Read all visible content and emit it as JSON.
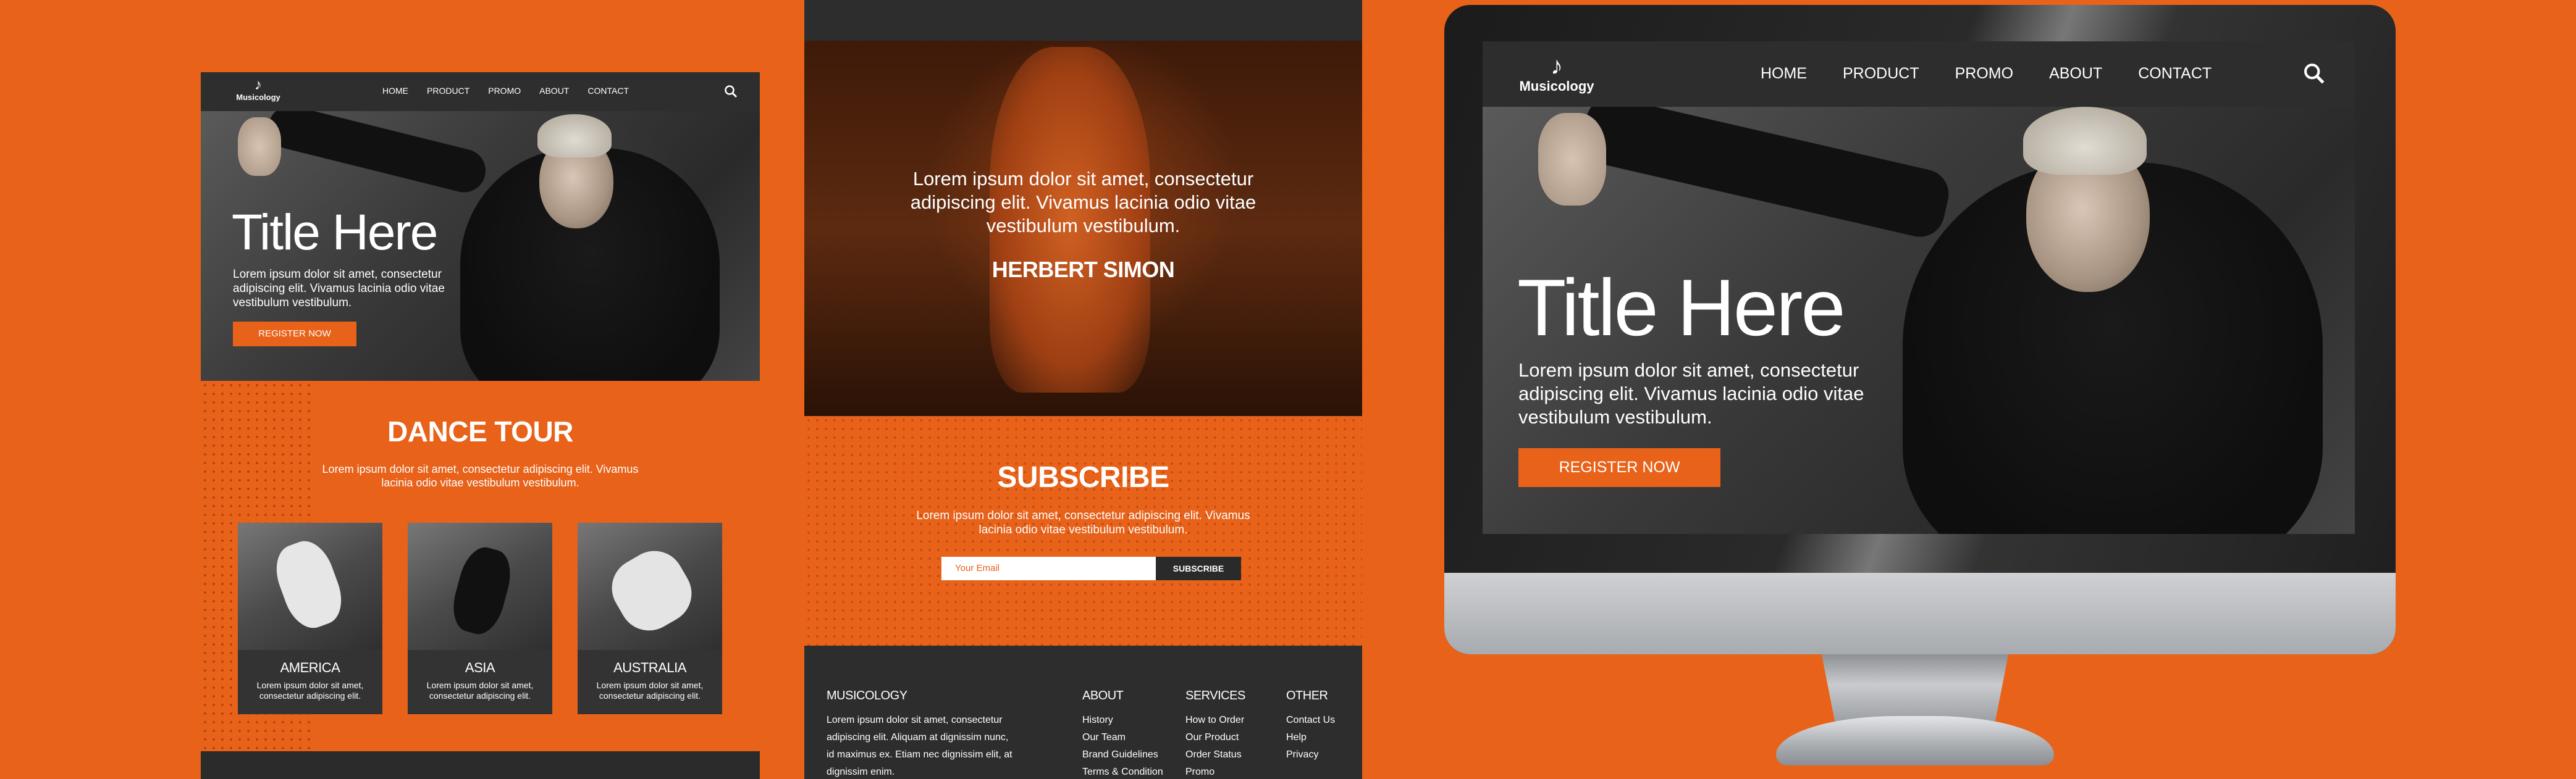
{
  "nav": {
    "brand": "Musicology",
    "links": [
      "HOME",
      "PRODUCT",
      "PROMO",
      "ABOUT",
      "CONTACT"
    ]
  },
  "hero": {
    "title": "Title Here",
    "text": "Lorem ipsum dolor sit amet, consectetur adipiscing elit. Vivamus lacinia odio vitae vestibulum vestibulum.",
    "button": "REGISTER NOW"
  },
  "tour": {
    "title": "DANCE TOUR",
    "text": "Lorem ipsum dolor sit amet, consectetur adipiscing elit. Vivamus lacinia odio vitae vestibulum vestibulum.",
    "cards": [
      {
        "title": "AMERICA",
        "text": "Lorem ipsum dolor sit amet, consectetur adipiscing elit."
      },
      {
        "title": "ASIA",
        "text": "Lorem ipsum dolor sit amet, consectetur adipiscing elit."
      },
      {
        "title": "AUSTRALIA",
        "text": "Lorem ipsum dolor sit amet, consectetur adipiscing elit."
      }
    ]
  },
  "quote": {
    "text": "Lorem ipsum dolor sit amet, consectetur adipiscing elit. Vivamus lacinia odio vitae vestibulum vestibulum.",
    "author": "HERBERT SIMON"
  },
  "subscribe": {
    "title": "SUBSCRIBE",
    "text": "Lorem ipsum dolor sit amet, consectetur adipiscing elit. Vivamus lacinia odio vitae vestibulum vestibulum.",
    "placeholder": "Your Email",
    "button": "SUBSCRIBE"
  },
  "footer": {
    "brand_heading": "MUSICOLOGY",
    "brand_text": "Lorem ipsum dolor sit amet, consectetur adipiscing elit. Aliquam at dignissim nunc, id maximus ex. Etiam nec dignissim elit, at dignissim enim.",
    "about": {
      "heading": "ABOUT",
      "items": [
        "History",
        "Our Team",
        "Brand Guidelines",
        "Terms & Condition"
      ]
    },
    "services": {
      "heading": "SERVICES",
      "items": [
        "How to Order",
        "Our Product",
        "Order Status",
        "Promo"
      ]
    },
    "other": {
      "heading": "OTHER",
      "items": [
        "Contact Us",
        "Help",
        "Privacy"
      ]
    }
  },
  "colors": {
    "accent": "#e8621a",
    "dark": "#2d2d2d"
  }
}
